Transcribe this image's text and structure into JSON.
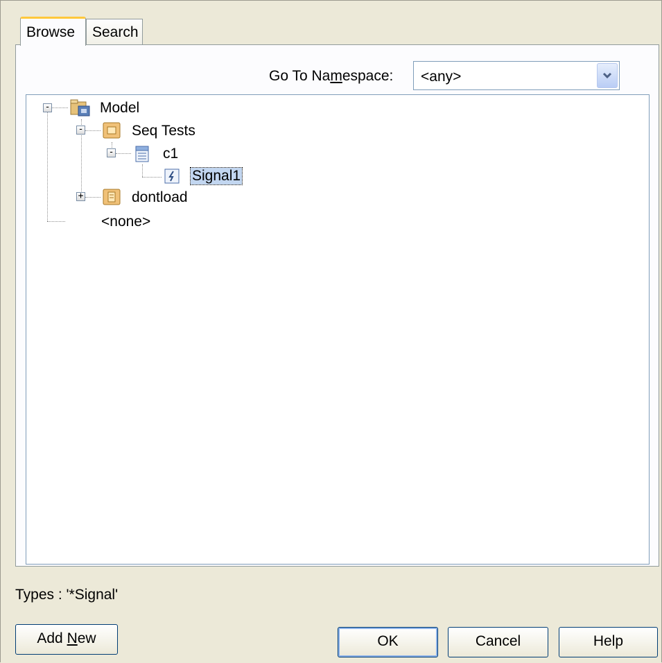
{
  "tabs": [
    {
      "label": "Browse",
      "active": true
    },
    {
      "label": "Search",
      "active": false
    }
  ],
  "namespace": {
    "label_pre": "Go To Na",
    "label_underlined": "m",
    "label_post": "espace:",
    "selected_value": "<any>"
  },
  "tree": {
    "nodes": [
      {
        "label": "Model",
        "icon": "model-package-icon",
        "expander": "-"
      },
      {
        "label": "Seq Tests",
        "icon": "package-icon",
        "expander": "-"
      },
      {
        "label": "c1",
        "icon": "class-icon",
        "expander": "-"
      },
      {
        "label": "Signal1",
        "icon": "signal-icon",
        "selected": true
      },
      {
        "label": "dontload",
        "icon": "package-icon",
        "expander": "+"
      },
      {
        "label": "<none>"
      }
    ]
  },
  "types_text": "Types : '*Signal'",
  "buttons": {
    "add_new_pre": "Add ",
    "add_new_underlined": "N",
    "add_new_post": "ew",
    "ok": "OK",
    "cancel": "Cancel",
    "help": "Help"
  },
  "colors": {
    "tab_accent": "#ffc83c",
    "selection": "#c2d6f0",
    "dialog_bg": "#ece9d8"
  }
}
